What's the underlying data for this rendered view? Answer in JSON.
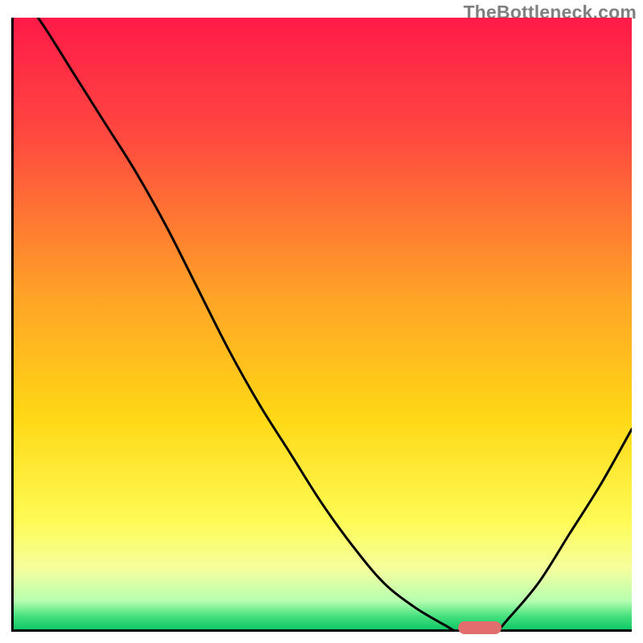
{
  "watermark": "TheBottleneck.com",
  "colors": {
    "curve": "#000000",
    "axis": "#000000",
    "marker": "#e26d6e",
    "watermark": "#808080"
  },
  "chart_data": {
    "type": "line",
    "title": "",
    "xlabel": "",
    "ylabel": "",
    "xlim": [
      0,
      100
    ],
    "ylim": [
      0,
      100
    ],
    "x": [
      0,
      5,
      10,
      15,
      20,
      25,
      30,
      35,
      40,
      45,
      50,
      55,
      60,
      65,
      70,
      72,
      75,
      78,
      80,
      85,
      90,
      95,
      100
    ],
    "values": [
      106,
      99,
      91,
      83,
      75,
      66,
      56,
      46,
      37,
      29,
      21,
      14,
      8,
      4,
      1,
      0,
      0,
      0,
      2,
      8,
      16,
      24,
      33
    ],
    "gradient": [
      {
        "offset": 0.0,
        "color": "#ff1a48"
      },
      {
        "offset": 0.2,
        "color": "#ff4b3f"
      },
      {
        "offset": 0.45,
        "color": "#ffa227"
      },
      {
        "offset": 0.65,
        "color": "#ffd815"
      },
      {
        "offset": 0.82,
        "color": "#fffb55"
      },
      {
        "offset": 0.9,
        "color": "#f4ffa0"
      },
      {
        "offset": 0.95,
        "color": "#b6ffb0"
      },
      {
        "offset": 0.975,
        "color": "#44e07d"
      },
      {
        "offset": 1.0,
        "color": "#08c463"
      }
    ],
    "marker": {
      "x_start": 72,
      "x_end": 79,
      "y": 0
    }
  }
}
